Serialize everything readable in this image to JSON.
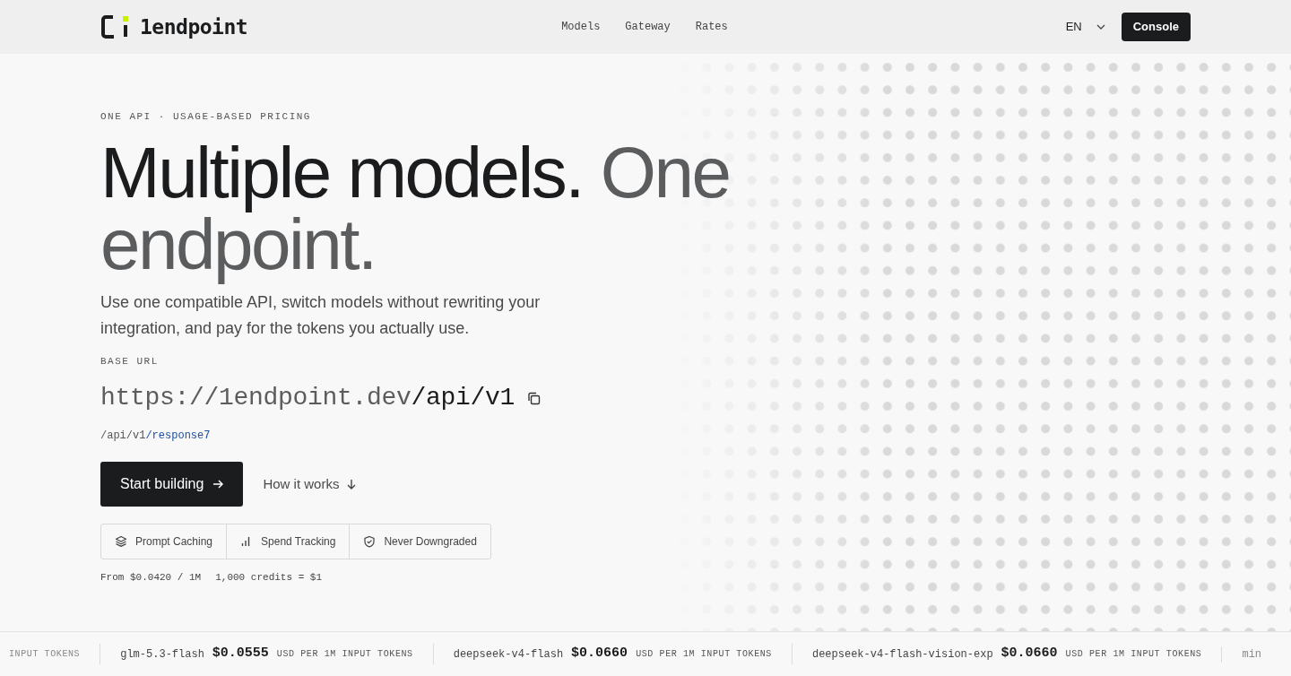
{
  "header": {
    "logo": "1endpoint",
    "nav": [
      "Models",
      "Gateway",
      "Rates"
    ],
    "language": "EN",
    "console_button": "Console"
  },
  "hero": {
    "eyebrow": "ONE API · USAGE-BASED PRICING",
    "headline_main": "Multiple models.",
    "headline_muted": "One endpoint.",
    "description": "Use one compatible API, switch models without rewriting your integration, and pay for the tokens you actually use.",
    "base_url_label": "BASE URL",
    "base_url_host": "https://1endpoint.dev",
    "base_url_path": "/api/v1",
    "path_prefix": "/api/v1",
    "path_suffix": "/response7",
    "primary_button": "Start building",
    "secondary_button": "How it works",
    "features": [
      {
        "kind": "layers",
        "label": "Prompt Caching"
      },
      {
        "kind": "bars",
        "label": "Spend Tracking"
      },
      {
        "kind": "shield",
        "label": "Never Downgraded"
      }
    ],
    "pricing_note": [
      "From $0.0420 / 1M",
      "1,000 credits = $1"
    ]
  },
  "ticker": [
    {
      "unit": "INPUT TOKENS"
    },
    {
      "model": "glm-5.3-flash",
      "price": "$0.0555",
      "unit": "USD PER 1M INPUT TOKENS"
    },
    {
      "model": "deepseek-v4-flash",
      "price": "$0.0660",
      "unit": "USD PER 1M INPUT TOKENS"
    },
    {
      "model": "deepseek-v4-flash-vision-exp",
      "price": "$0.0660",
      "unit": "USD PER 1M INPUT TOKENS"
    },
    {
      "model": "min"
    }
  ]
}
